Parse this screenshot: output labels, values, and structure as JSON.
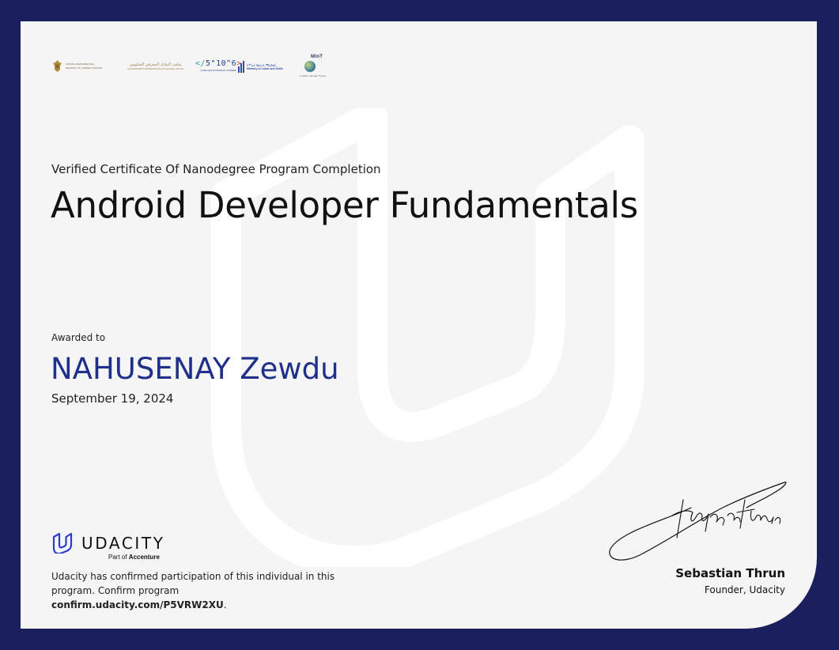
{
  "certificate": {
    "subtitle": "Verified Certificate Of Nanodegree Program Completion",
    "title": "Android Developer Fundamentals",
    "awarded_label": "Awarded to",
    "recipient": "NAHUSENAY Zewdu",
    "date": "September 19, 2024"
  },
  "partner_logos": {
    "uae": {
      "line1": "UNITED ARAB EMIRATES",
      "line2": "MINISTRY OF CABINET AFFAIRS"
    },
    "gov": {
      "arabic": "مكتب التبادل المعرفي الحكومي",
      "english": "GOVERNMENT EXPERIENCE EXCHANGE OFFICE"
    },
    "five_ten_six": {
      "mark": "5\"10^6",
      "caption": "5 MILLION ETHIOPIAN CODERS"
    },
    "mols": {
      "amharic": "የሥራና ክህሎት ሚኒስቴር",
      "english": "Ministry of Labor and Skills"
    },
    "mint": {
      "mark": "MInT",
      "caption": "ኢኖቬሽንና ቴክኖሎጂ ሚኒስቴር"
    }
  },
  "brand": {
    "name": "UDACITY",
    "tagline_prefix": "Part of ",
    "tagline_company": "Accenture"
  },
  "confirmation": {
    "text": "Udacity has confirmed participation of this individual in this program. Confirm program ",
    "link": "confirm.udacity.com/P5VRW2XU",
    "suffix": "."
  },
  "signatory": {
    "name": "Sebastian Thrun",
    "role": "Founder, Udacity"
  },
  "colors": {
    "frame": "#1c1f5e",
    "card": "#f5f5f5",
    "recipient": "#1f2f8a",
    "brand_icon": "#2e3bd1"
  }
}
